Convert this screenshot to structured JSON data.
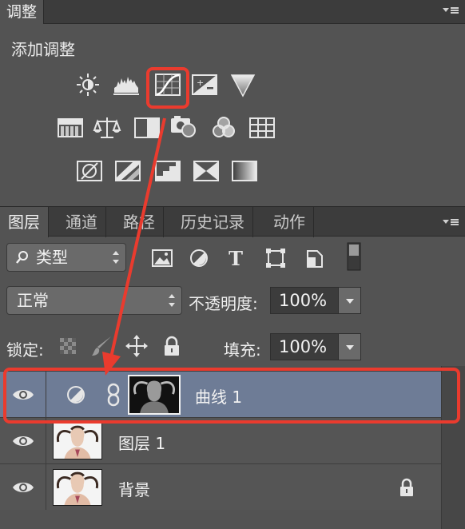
{
  "adjustments": {
    "tab_label": "调整",
    "heading": "添加调整",
    "icons": [
      "brightness-contrast-icon",
      "levels-icon",
      "curves-icon",
      "exposure-icon",
      "vibrance-icon",
      "hue-saturation-icon",
      "color-balance-icon",
      "black-white-icon",
      "photo-filter-icon",
      "channel-mixer-icon",
      "color-lookup-icon",
      "invert-icon",
      "posterize-icon",
      "threshold-icon",
      "selective-color-icon",
      "gradient-map-icon"
    ]
  },
  "layers_panel": {
    "tabs": [
      "图层",
      "通道",
      "路径",
      "历史记录",
      "动作"
    ],
    "filter": {
      "value": "类型"
    },
    "filter_icons": [
      "pixel-filter-icon",
      "adjustment-filter-icon",
      "type-filter-icon",
      "shape-filter-icon",
      "smart-object-filter-icon",
      "filter-toggle-icon"
    ],
    "blend": {
      "mode": "正常",
      "opacity_label": "不透明度:",
      "opacity_value": "100%"
    },
    "lock": {
      "label": "锁定:",
      "fill_label": "填充:",
      "fill_value": "100%"
    },
    "layers": [
      {
        "name": "曲线 1",
        "selected": true,
        "type": "adjustment"
      },
      {
        "name": "图层 1",
        "selected": false,
        "type": "pixel"
      },
      {
        "name": "背景",
        "selected": false,
        "type": "background",
        "locked": true
      }
    ]
  },
  "annotation": {
    "color": "#ea3b2e"
  }
}
